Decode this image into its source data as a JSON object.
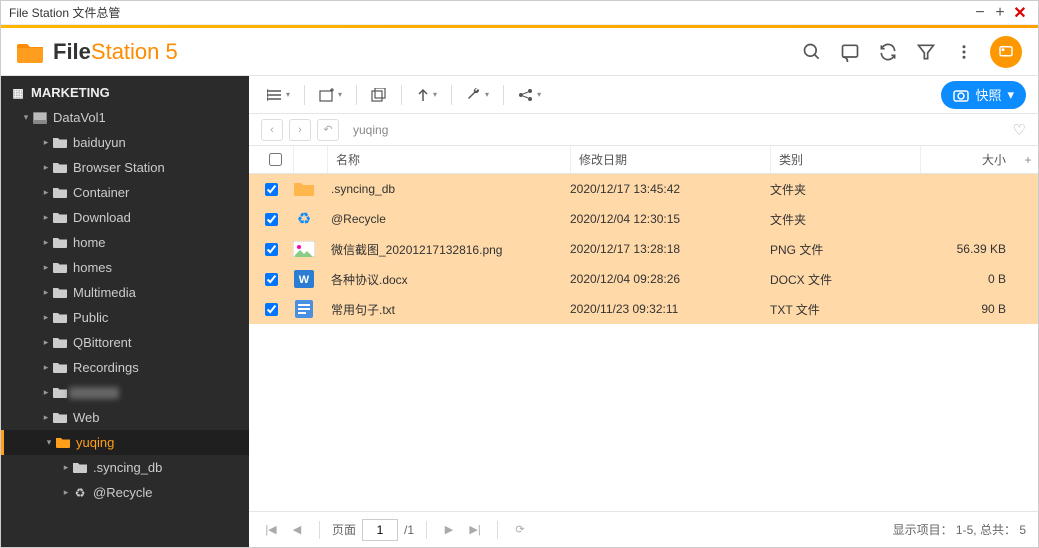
{
  "window": {
    "title": "File Station 文件总管"
  },
  "app": {
    "name_bold": "File",
    "name_light": "Station 5"
  },
  "snapshot_label": "快照",
  "breadcrumb": {
    "path": "yuqing"
  },
  "sidebar": {
    "root": "MARKETING",
    "volume": "DataVol1",
    "items": [
      "baiduyun",
      "Browser Station",
      "Container",
      "Download",
      "home",
      "homes",
      "Multimedia",
      "Public",
      "QBittorent",
      "Recordings",
      "",
      "Web",
      "yuqing"
    ],
    "sub": [
      ".syncing_db",
      "@Recycle"
    ]
  },
  "columns": {
    "name": "名称",
    "date": "修改日期",
    "type": "类别",
    "size": "大小"
  },
  "rows": [
    {
      "icon": "folder",
      "name": ".syncing_db",
      "date": "2020/12/17 13:45:42",
      "type": "文件夹",
      "size": ""
    },
    {
      "icon": "recycle",
      "name": "@Recycle",
      "date": "2020/12/04 12:30:15",
      "type": "文件夹",
      "size": ""
    },
    {
      "icon": "png",
      "name": "微信截图_20201217132816.png",
      "date": "2020/12/17 13:28:18",
      "type": "PNG 文件",
      "size": "56.39 KB"
    },
    {
      "icon": "docx",
      "name": "各种协议.docx",
      "date": "2020/12/04 09:28:26",
      "type": "DOCX 文件",
      "size": "0 B"
    },
    {
      "icon": "txt",
      "name": "常用句子.txt",
      "date": "2020/11/23 09:32:11",
      "type": "TXT 文件",
      "size": "90 B"
    }
  ],
  "footer": {
    "page_label": "页面",
    "page_current": "1",
    "page_total": "/1",
    "status_prefix": "显示项目：",
    "status_range": "1-5,",
    "status_total_label": "总共：",
    "status_total": "5"
  }
}
